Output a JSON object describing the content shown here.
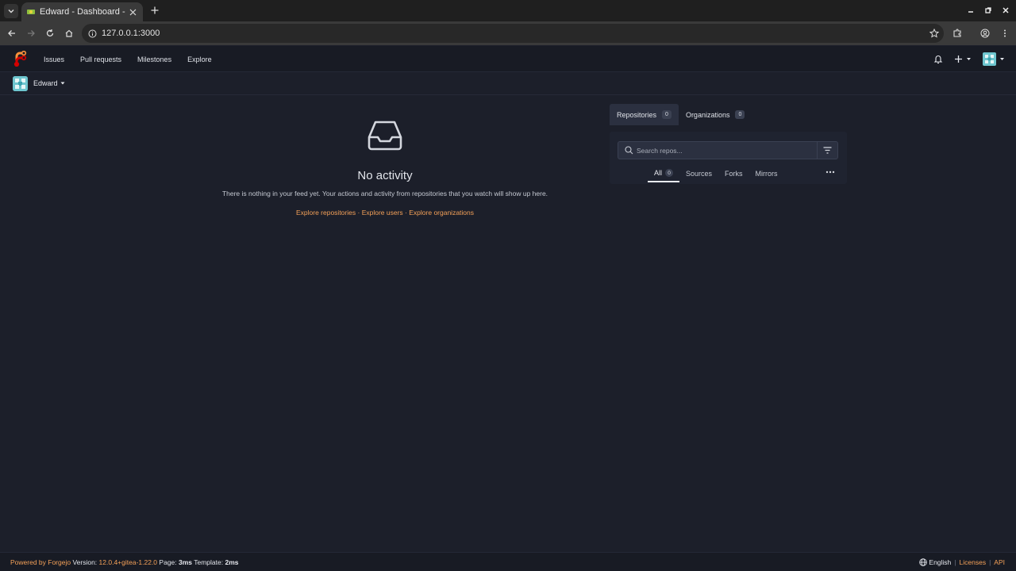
{
  "browser": {
    "tab_title": "Edward - Dashboard - ",
    "url": "127.0.0.1:3000"
  },
  "navbar": {
    "links": [
      "Issues",
      "Pull requests",
      "Milestones",
      "Explore"
    ]
  },
  "context": {
    "user": "Edward"
  },
  "feed": {
    "title": "No activity",
    "description": "There is nothing in your feed yet. Your actions and activity from repositories that you watch will show up here.",
    "links": [
      "Explore repositories",
      "Explore users",
      "Explore organizations"
    ],
    "link_separator": "·"
  },
  "panel": {
    "tabs": [
      {
        "label": "Repositories",
        "count": "0"
      },
      {
        "label": "Organizations",
        "count": "0"
      }
    ],
    "search_placeholder": "Search repos...",
    "subtabs": [
      {
        "label": "All",
        "count": "0"
      },
      {
        "label": "Sources"
      },
      {
        "label": "Forks"
      },
      {
        "label": "Mirrors"
      }
    ]
  },
  "footer": {
    "powered": "Powered by Forgejo",
    "version_label": "Version:",
    "version": "12.0.4+gitea-1.22.0",
    "page_label": "Page:",
    "page_time": "3ms",
    "template_label": "Template:",
    "template_time": "2ms",
    "language": "English",
    "licenses": "Licenses",
    "api": "API"
  },
  "colors": {
    "accent": "#f3a058",
    "background": "#1c1f2a"
  }
}
